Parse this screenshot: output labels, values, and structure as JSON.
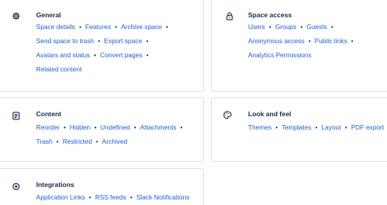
{
  "sections": {
    "general": {
      "title": "General",
      "icon": "gear-icon",
      "rows": [
        [
          "Space details",
          "Features",
          "Archive space"
        ],
        [
          "Send space to trash",
          "Export space"
        ],
        [
          "Avatars and status",
          "Convert pages"
        ],
        [
          "Related content"
        ]
      ]
    },
    "space_access": {
      "title": "Space access",
      "icon": "lock-icon",
      "rows": [
        [
          "Users",
          "Groups",
          "Guests"
        ],
        [
          "Anonymous access",
          "Public links"
        ],
        [
          "Analytics Permissions"
        ]
      ]
    },
    "content": {
      "title": "Content",
      "icon": "page-icon",
      "rows": [
        [
          "Reorder",
          "Hidden",
          "Undefined",
          "Attachments"
        ],
        [
          "Trash",
          "Restricted",
          "Archived"
        ]
      ]
    },
    "look_and_feel": {
      "title": "Look and feel",
      "icon": "palette-icon",
      "rows": [
        [
          "Themes",
          "Templates",
          "Layout",
          "PDF export"
        ]
      ]
    },
    "integrations": {
      "title": "Integrations",
      "icon": "integration-icon",
      "rows": [
        [
          "Application Links",
          "RSS feeds",
          "Slack Notifications"
        ]
      ]
    }
  },
  "colors": {
    "link": "#1d5fd6",
    "heading": "#172b4d",
    "border": "#dcdfe4"
  }
}
